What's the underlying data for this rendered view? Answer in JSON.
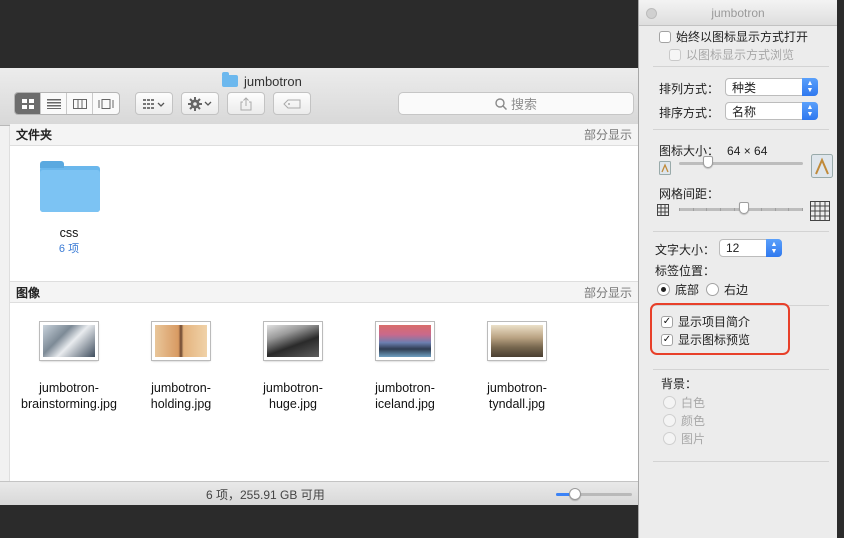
{
  "finder": {
    "window_title": "jumbotron",
    "search_placeholder": "搜索",
    "sections": {
      "folders": {
        "title": "文件夹",
        "action": "部分显示"
      },
      "images": {
        "title": "图像",
        "action": "部分显示"
      }
    },
    "folder_item": {
      "name": "css",
      "count": "6 项"
    },
    "images": [
      {
        "name1": "jumbotron-",
        "name2": "brainstorming.jpg"
      },
      {
        "name1": "jumbotron-",
        "name2": "holding.jpg"
      },
      {
        "name1": "jumbotron-",
        "name2": "huge.jpg"
      },
      {
        "name1": "jumbotron-",
        "name2": "iceland.jpg"
      },
      {
        "name1": "jumbotron-",
        "name2": "tyndall.jpg"
      }
    ],
    "status": "6 项，255.91 GB 可用",
    "icon_size_level": 0.25
  },
  "panel": {
    "title": "jumbotron",
    "always_open_icon_view": "始终以图标显示方式打开",
    "browse_icon_view": "以图标显示方式浏览",
    "arrange_by_label": "排列方式：",
    "arrange_by_value": "种类",
    "sort_by_label": "排序方式：",
    "sort_by_value": "名称",
    "icon_size_label": "图标大小：",
    "icon_size_value": "64 × 64",
    "icon_size_level": 0.24,
    "grid_spacing_label": "网格间距：",
    "grid_spacing_level": 0.53,
    "text_size_label": "文字大小：",
    "text_size_value": "12",
    "label_position_label": "标签位置：",
    "label_bottom": "底部",
    "label_right": "右边",
    "show_item_info": "显示项目简介",
    "show_icon_preview": "显示图标预览",
    "background_label": "背景：",
    "bg_white": "白色",
    "bg_color": "颜色",
    "bg_picture": "图片"
  }
}
